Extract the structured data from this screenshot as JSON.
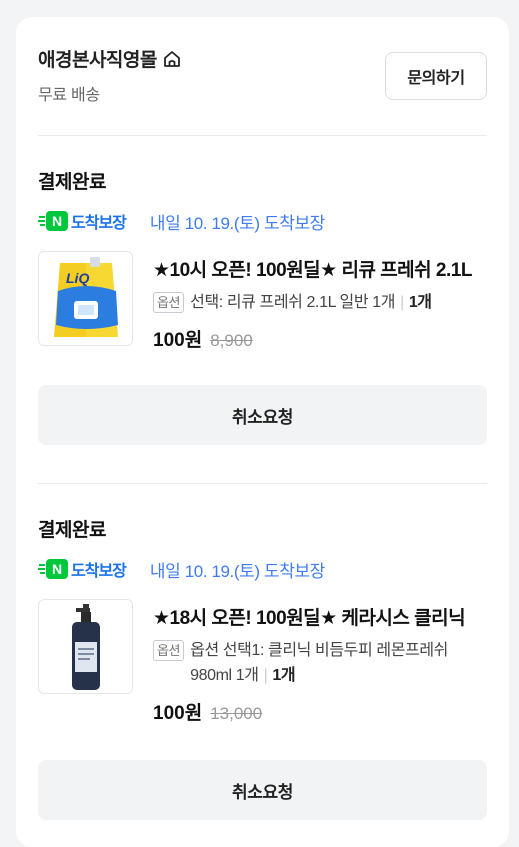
{
  "seller": {
    "name": "애경본사직영몰",
    "shipping": "무료 배송",
    "inquiry_label": "문의하기"
  },
  "colors": {
    "accent_blue": "#3f7cf2",
    "guarantee_green": "#00c73c",
    "button_bg": "#f1f3f5"
  },
  "orders": [
    {
      "status": "결제완료",
      "guarantee_badge": "N",
      "guarantee_label": "도착보장",
      "delivery": "내일 10. 19.(토) 도착보장",
      "title": "★10시 오픈! 100원딜★ 리큐 프레쉬 2.1L",
      "option_tag": "옵션",
      "option": "선택: 리큐 프레쉬 2.1L 일반 1개",
      "quantity": "1개",
      "price": "100원",
      "original_price": "8,900",
      "thumb_icon": "detergent-pouch-icon",
      "cancel_label": "취소요청"
    },
    {
      "status": "결제완료",
      "guarantee_badge": "N",
      "guarantee_label": "도착보장",
      "delivery": "내일 10. 19.(토) 도착보장",
      "title": "★18시 오픈! 100원딜★ 케라시스 클리닉",
      "option_tag": "옵션",
      "option": "옵션 선택1: 클리닉 비듬두피 레몬프레쉬 980ml 1개",
      "quantity": "1개",
      "price": "100원",
      "original_price": "13,000",
      "thumb_icon": "shampoo-bottle-icon",
      "cancel_label": "취소요청"
    }
  ]
}
